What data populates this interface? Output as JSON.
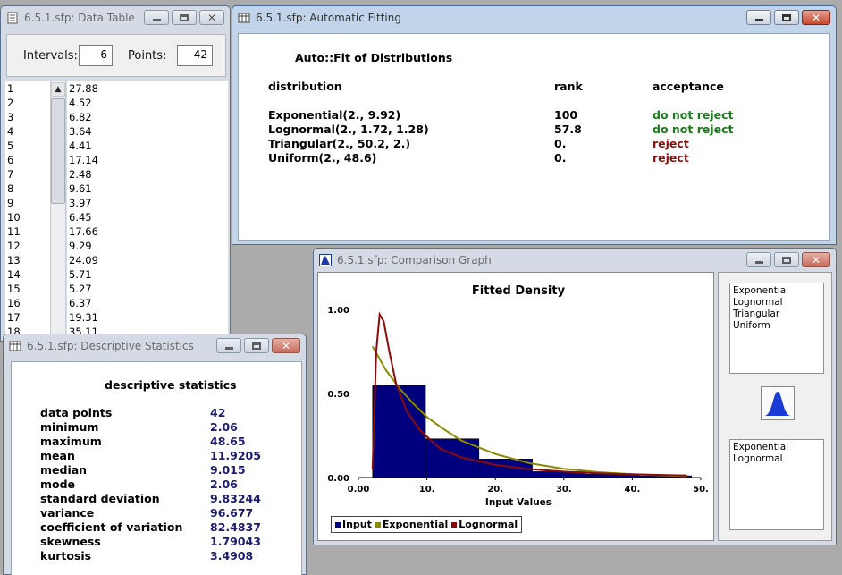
{
  "data_table": {
    "title": "6.5.1.sfp: Data Table",
    "intervals_label": "Intervals:",
    "intervals_value": "6",
    "points_label": "Points:",
    "points_value": "42",
    "rows": [
      {
        "n": "1",
        "v": "27.88"
      },
      {
        "n": "2",
        "v": "4.52"
      },
      {
        "n": "3",
        "v": "6.82"
      },
      {
        "n": "4",
        "v": "3.64"
      },
      {
        "n": "5",
        "v": "4.41"
      },
      {
        "n": "6",
        "v": "17.14"
      },
      {
        "n": "7",
        "v": "2.48"
      },
      {
        "n": "8",
        "v": "9.61"
      },
      {
        "n": "9",
        "v": "3.97"
      },
      {
        "n": "10",
        "v": "6.45"
      },
      {
        "n": "11",
        "v": "17.66"
      },
      {
        "n": "12",
        "v": "9.29"
      },
      {
        "n": "13",
        "v": "24.09"
      },
      {
        "n": "14",
        "v": "5.71"
      },
      {
        "n": "15",
        "v": "5.27"
      },
      {
        "n": "16",
        "v": "6.37"
      },
      {
        "n": "17",
        "v": "19.31"
      },
      {
        "n": "18",
        "v": "35.11"
      }
    ]
  },
  "fitting": {
    "title": "6.5.1.sfp: Automatic Fitting",
    "heading": "Auto::Fit of Distributions",
    "col_distribution": "distribution",
    "col_rank": "rank",
    "col_acceptance": "acceptance",
    "rows": [
      {
        "dist": "Exponential(2., 9.92)",
        "rank": "100",
        "accept": "do not reject"
      },
      {
        "dist": "Lognormal(2., 1.72, 1.28)",
        "rank": "57.8",
        "accept": "do not reject"
      },
      {
        "dist": "Triangular(2., 50.2, 2.)",
        "rank": "0.",
        "accept": "reject"
      },
      {
        "dist": "Uniform(2., 48.6)",
        "rank": "0.",
        "accept": "reject"
      }
    ],
    "colors": {
      "accept": "#1a7a1a",
      "reject": "#8a0f0f"
    }
  },
  "stats": {
    "title": "6.5.1.sfp: Descriptive Statistics",
    "heading": "descriptive statistics",
    "rows": [
      {
        "name": "data points",
        "value": "42"
      },
      {
        "name": "minimum",
        "value": "2.06"
      },
      {
        "name": "maximum",
        "value": "48.65"
      },
      {
        "name": "mean",
        "value": "11.9205"
      },
      {
        "name": "median",
        "value": "9.015"
      },
      {
        "name": "mode",
        "value": "2.06"
      },
      {
        "name": "standard deviation",
        "value": "9.83244"
      },
      {
        "name": "variance",
        "value": "96.677"
      },
      {
        "name": "coefficient of variation",
        "value": "82.4837"
      },
      {
        "name": "skewness",
        "value": "1.79043"
      },
      {
        "name": "kurtosis",
        "value": "3.4908"
      }
    ]
  },
  "graph": {
    "title": "6.5.1.sfp: Comparison Graph",
    "list_all": [
      "Exponential",
      "Lognormal",
      "Triangular",
      "Uniform"
    ],
    "list_selected": [
      "Exponential",
      "Lognormal"
    ],
    "legend": [
      "Input",
      "Exponential",
      "Lognormal"
    ],
    "colors": {
      "input": "#00007f",
      "exponential": "#8a8a00",
      "lognormal": "#8b0a0a"
    }
  },
  "chart_data": {
    "type": "bar",
    "title": "Fitted Density",
    "xlabel": "Input Values",
    "ylabel": "",
    "xlim": [
      0,
      50
    ],
    "ylim": [
      0,
      1
    ],
    "x_ticks": [
      "0.00",
      "10.",
      "20.",
      "30.",
      "40.",
      "50."
    ],
    "y_ticks": [
      "0.00",
      "0.50",
      "1.00"
    ],
    "bins": [
      {
        "from": 2.06,
        "to": 9.8,
        "value": 0.55
      },
      {
        "from": 9.8,
        "to": 17.6,
        "value": 0.23
      },
      {
        "from": 17.6,
        "to": 25.4,
        "value": 0.11
      },
      {
        "from": 25.4,
        "to": 33.2,
        "value": 0.035
      },
      {
        "from": 33.2,
        "to": 41.0,
        "value": 0.02
      },
      {
        "from": 41.0,
        "to": 48.65,
        "value": 0.01
      }
    ],
    "series": [
      {
        "name": "Exponential",
        "x": [
          2.06,
          4,
          6,
          8,
          10,
          12,
          15,
          20,
          25,
          30,
          35,
          40,
          45,
          48
        ],
        "y": [
          0.78,
          0.64,
          0.53,
          0.44,
          0.36,
          0.3,
          0.22,
          0.14,
          0.085,
          0.052,
          0.032,
          0.02,
          0.012,
          0.009
        ]
      },
      {
        "name": "Lognormal",
        "x": [
          2.06,
          2.6,
          3.1,
          3.7,
          4.5,
          5.5,
          7,
          9,
          12,
          15,
          20,
          25,
          30,
          35,
          40,
          45,
          48
        ],
        "y": [
          0.05,
          0.75,
          0.97,
          0.93,
          0.75,
          0.56,
          0.4,
          0.28,
          0.17,
          0.12,
          0.075,
          0.05,
          0.035,
          0.025,
          0.019,
          0.015,
          0.012
        ]
      }
    ],
    "legend_position": "bottom-left"
  }
}
